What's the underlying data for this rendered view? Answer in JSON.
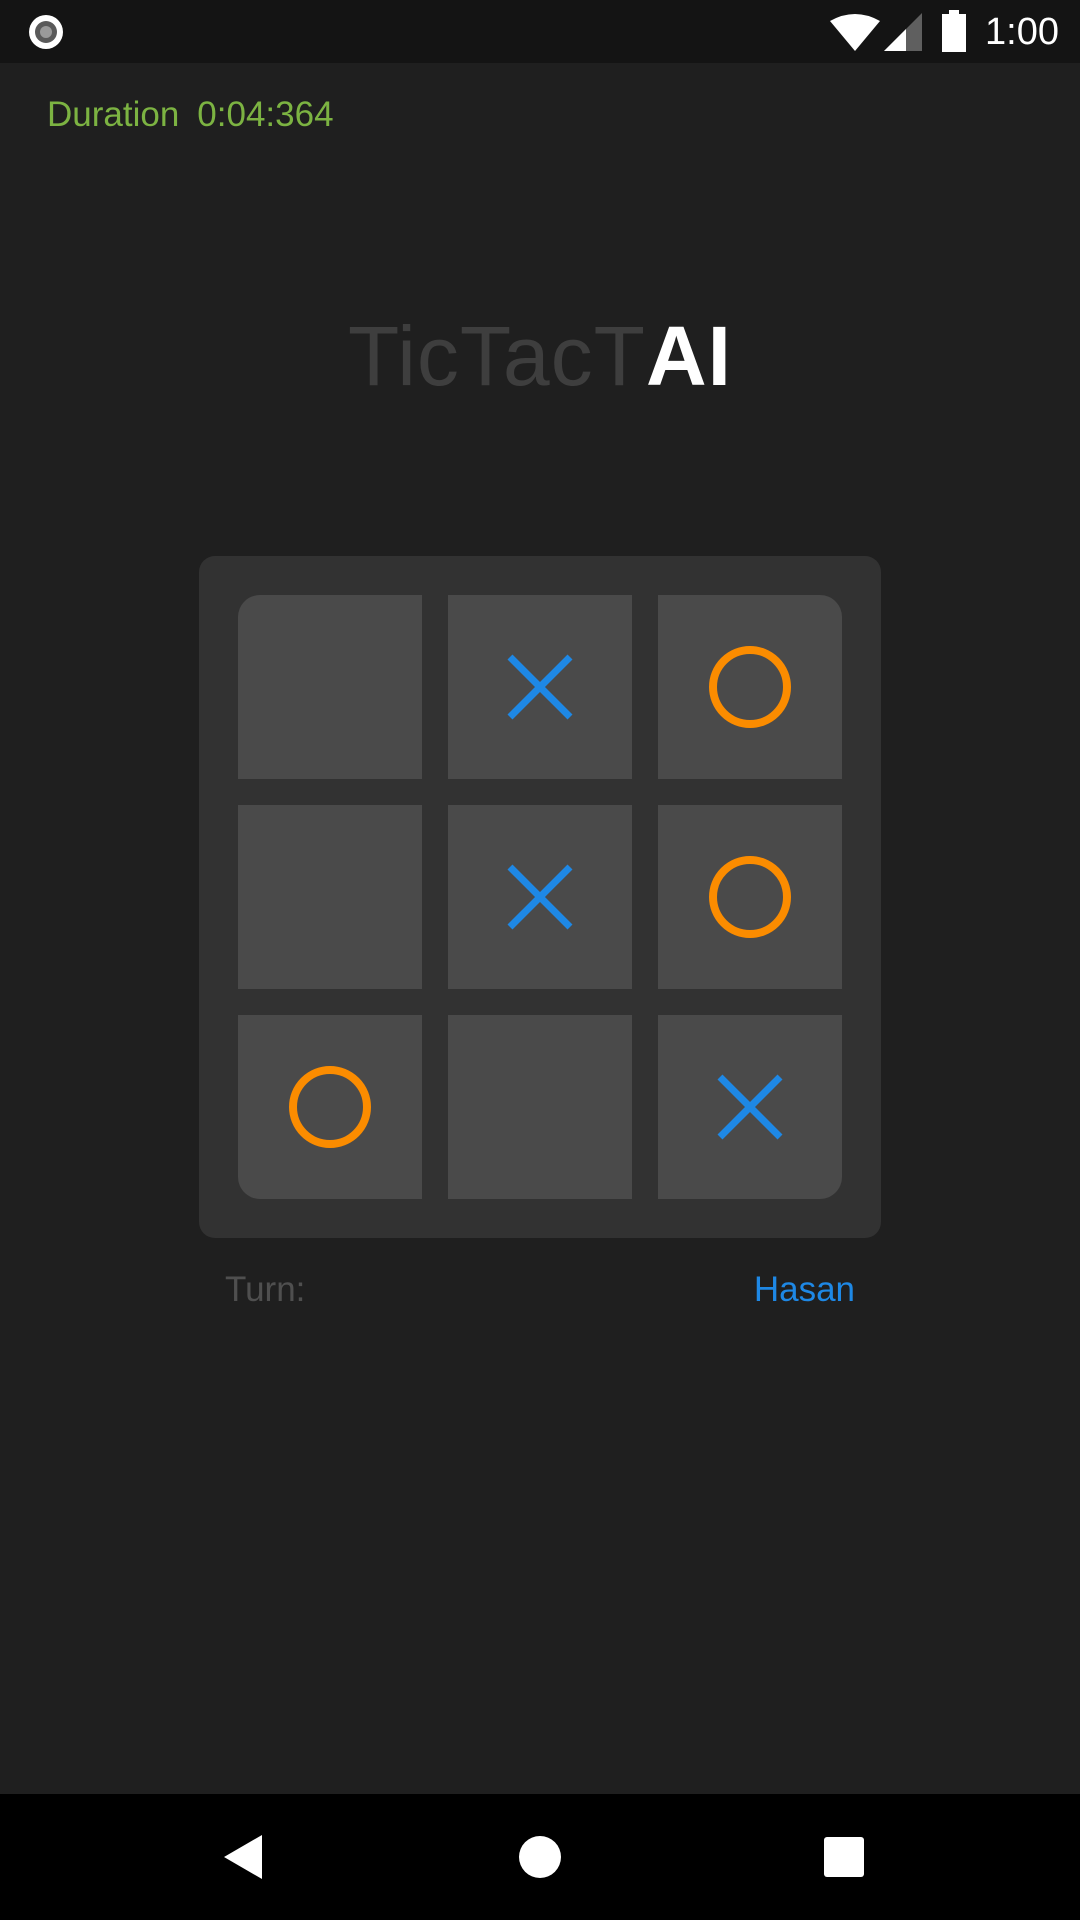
{
  "status_bar": {
    "time": "1:00",
    "icons": [
      "record-icon",
      "wifi-icon",
      "cell-signal-icon",
      "battery-icon"
    ]
  },
  "duration": {
    "label": "Duration",
    "value": "0:04:364"
  },
  "title": {
    "light": "TicTacT",
    "bold": "AI"
  },
  "board": {
    "cells": [
      "",
      "X",
      "O",
      "",
      "X",
      "O",
      "O",
      "",
      "X"
    ]
  },
  "turn": {
    "label": "Turn:",
    "player": "Hasan"
  },
  "nav_bar": {
    "icons": [
      "back-icon",
      "home-icon",
      "recents-icon"
    ]
  },
  "colors": {
    "background": "#1f1f1f",
    "board": "#323232",
    "cell": "#4a4a4a",
    "x_mark": "#1e88e5",
    "o_mark": "#fb8c00",
    "duration": "#7cb342",
    "title_light": "#3e3e3e",
    "title_bold": "#ffffff",
    "turn_label": "#4f4f4f",
    "turn_player": "#1e88e5"
  }
}
